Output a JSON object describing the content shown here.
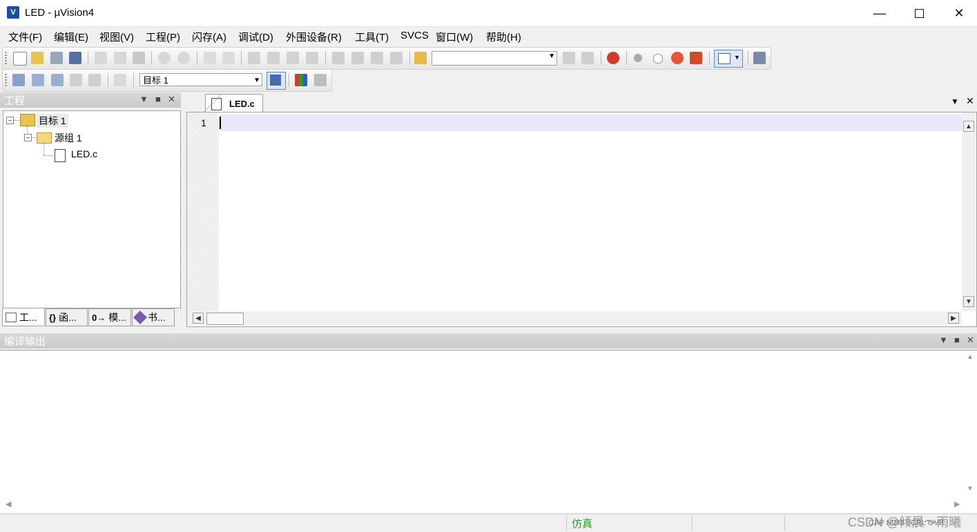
{
  "window": {
    "title": "LED  - µVision4",
    "icon_text": "V"
  },
  "menu": {
    "items": [
      "文件(F)",
      "编辑(E)",
      "视图(V)",
      "工程(P)",
      "闪存(A)",
      "调试(D)",
      "外围设备(R)",
      "工具(T)",
      "SVCS",
      "窗口(W)",
      "帮助(H)"
    ]
  },
  "toolbar": {
    "target_select": "目标 1",
    "find_combo": ""
  },
  "project_panel": {
    "title": "工程",
    "tree": {
      "root": "目标 1",
      "group": "源组 1",
      "file": "LED.c"
    },
    "tabs": [
      "工...",
      "函...",
      "模...",
      "书..."
    ]
  },
  "editor": {
    "tab_label": "LED.c",
    "line_number": "1"
  },
  "output_panel": {
    "title": "编译输出"
  },
  "statusbar": {
    "mode": "仿真",
    "indicators": "CAP  NUM  SCRL  OVR",
    "watermark": "CSDN @倾晨～雨曦"
  },
  "colors": {
    "mode_text": "#2a9a2a",
    "current_line": "#e8e8fa",
    "panel_header": "#cfcfcf"
  }
}
